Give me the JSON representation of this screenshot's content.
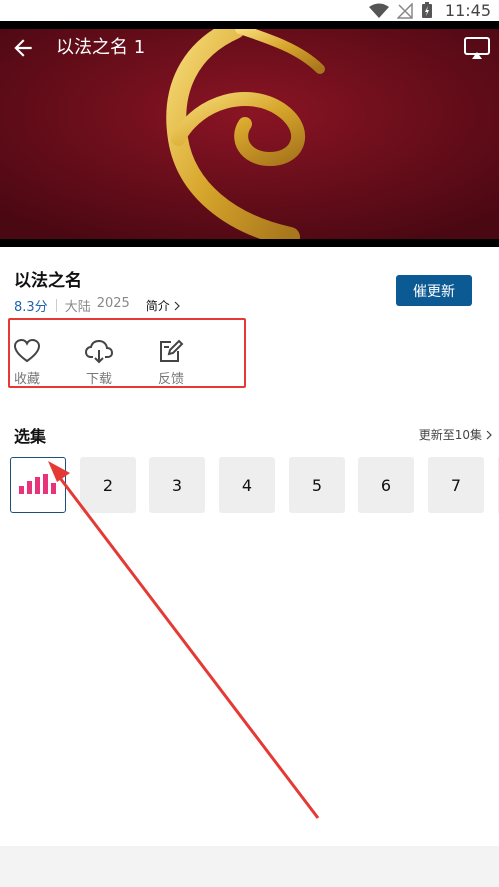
{
  "status_bar": {
    "time": "11:45"
  },
  "player": {
    "title": "以法之名 1"
  },
  "show": {
    "title": "以法之名",
    "rating": "8.3分",
    "region": "大陆",
    "year": "2025",
    "intro_label": "简介"
  },
  "urge_button": {
    "label": "催更新"
  },
  "actions": [
    {
      "label": "收藏",
      "icon": "heart-icon"
    },
    {
      "label": "下载",
      "icon": "cloud-download-icon"
    },
    {
      "label": "反馈",
      "icon": "edit-icon"
    }
  ],
  "episodes": {
    "title": "选集",
    "update_info": "更新至10集",
    "items": [
      "2",
      "3",
      "4",
      "5",
      "6",
      "7"
    ]
  },
  "colors": {
    "accent_blue": "#0c5a93",
    "rating_blue": "#1e63b0",
    "annotation_red": "#e53935",
    "playing_pink": "#e8337a"
  }
}
